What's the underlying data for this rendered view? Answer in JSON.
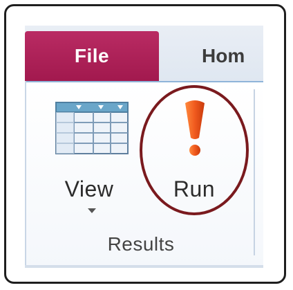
{
  "tabs": {
    "file_label": "File",
    "home_label": "Hom"
  },
  "commands": {
    "view": {
      "label": "View",
      "icon": "datasheet-view-icon",
      "has_dropdown": true
    },
    "run": {
      "label": "Run",
      "icon": "exclamation-run-icon"
    }
  },
  "group": {
    "label": "Results"
  },
  "colors": {
    "file_tab": "#a51f55",
    "run_icon": "#f05a1e",
    "highlight_ring": "#7a1a1e",
    "ribbon_accent": "#8fb4d9"
  }
}
